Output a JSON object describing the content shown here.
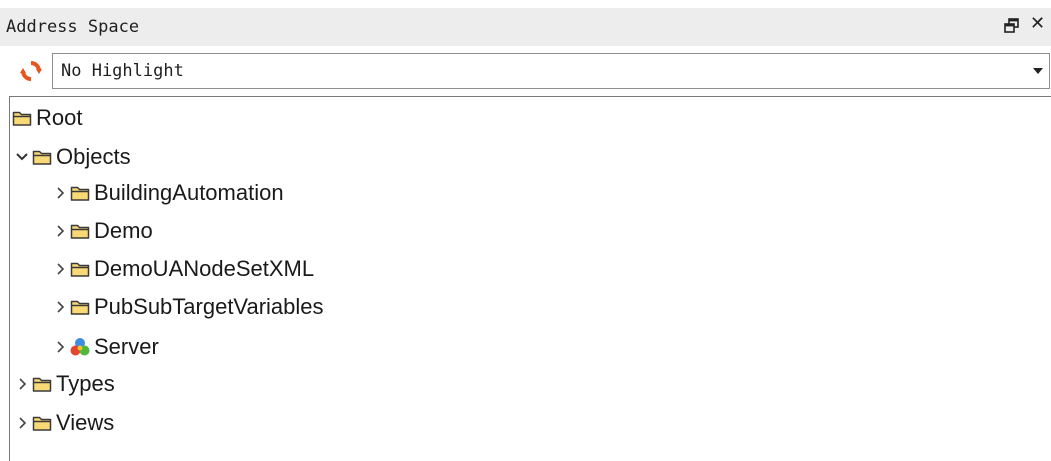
{
  "panel": {
    "title": "Address Space",
    "highlight_value": "No Highlight",
    "icons": {
      "refresh": "refresh-icon",
      "pin": "float-window-icon",
      "close": "close-icon",
      "dropdown": "dropdown-arrow-icon"
    }
  },
  "colors": {
    "title_bar": "#ededed",
    "folder_fill": "#f9d976",
    "folder_stroke": "#3a3a3a",
    "refresh_accent": "#e8541e"
  },
  "tree": {
    "nodes": [
      {
        "label": "Root",
        "icon": "folder-icon",
        "expander": "none"
      },
      {
        "label": "Objects",
        "icon": "folder-icon",
        "expander": "expanded"
      },
      {
        "label": "BuildingAutomation",
        "icon": "folder-icon",
        "expander": "collapsed"
      },
      {
        "label": "Demo",
        "icon": "folder-icon",
        "expander": "collapsed"
      },
      {
        "label": "DemoUANodeSetXML",
        "icon": "folder-icon",
        "expander": "collapsed"
      },
      {
        "label": "PubSubTargetVariables",
        "icon": "folder-icon",
        "expander": "collapsed"
      },
      {
        "label": "Server",
        "icon": "server-object-icon",
        "expander": "collapsed"
      },
      {
        "label": "Types",
        "icon": "folder-icon",
        "expander": "collapsed"
      },
      {
        "label": "Views",
        "icon": "folder-icon",
        "expander": "collapsed"
      }
    ]
  }
}
